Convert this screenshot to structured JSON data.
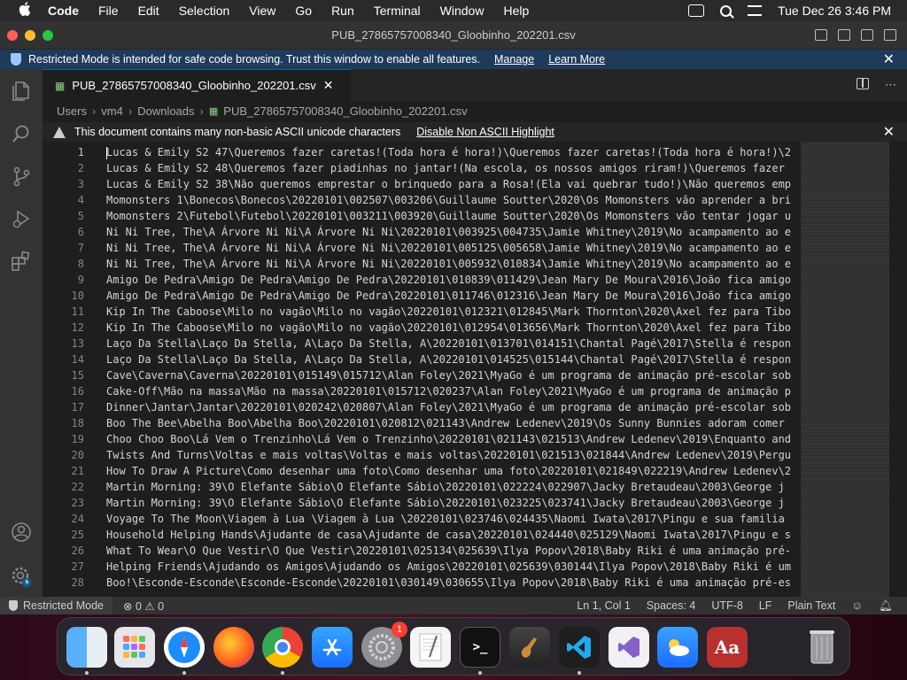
{
  "menubar": {
    "apple": "",
    "items": [
      "Code",
      "File",
      "Edit",
      "Selection",
      "View",
      "Go",
      "Run",
      "Terminal",
      "Window",
      "Help"
    ],
    "datetime": "Tue Dec 26  3:46 PM"
  },
  "window": {
    "title": "PUB_27865757008340_Gloobinho_202201.csv"
  },
  "banner": {
    "text": "Restricted Mode is intended for safe code browsing. Trust this window to enable all features.",
    "manage": "Manage",
    "learn_more": "Learn More",
    "close": "✕"
  },
  "tab": {
    "icon": "▦",
    "label": "PUB_27865757008340_Gloobinho_202201.csv",
    "close": "✕"
  },
  "breadcrumbs": [
    "Users",
    "vm4",
    "Downloads",
    "PUB_27865757008340_Gloobinho_202201.csv"
  ],
  "warning": {
    "text": "This document contains many non-basic ASCII unicode characters",
    "action": "Disable Non ASCII Highlight",
    "close": "✕"
  },
  "editor": {
    "lines": [
      {
        "n": "1",
        "text": "Lucas & Emily S2 47\\Queremos fazer caretas!(Toda hora é hora!)\\Queremos fazer caretas!(Toda hora é hora!)\\2"
      },
      {
        "n": "2",
        "text": "Lucas & Emily S2 48\\Queremos fazer piadinhas no jantar!(Na escola, os nossos amigos riram!)\\Queremos fazer"
      },
      {
        "n": "3",
        "text": "Lucas & Emily S2 38\\Não queremos emprestar o brinquedo para a Rosa!(Ela vai quebrar tudo!)\\Não queremos emp"
      },
      {
        "n": "4",
        "text": "Momonsters 1\\Bonecos\\Bonecos\\20220101\\002507\\003206\\Guillaume Soutter\\2020\\Os Momonsters vão aprender a bri"
      },
      {
        "n": "5",
        "text": "Momonsters 2\\Futebol\\Futebol\\20220101\\003211\\003920\\Guillaume Soutter\\2020\\Os Momonsters vão tentar jogar u"
      },
      {
        "n": "6",
        "text": "Ni Ni Tree, The\\A Árvore Ni Ni\\A Árvore Ni Ni\\20220101\\003925\\004735\\Jamie Whitney\\2019\\No acampamento ao e"
      },
      {
        "n": "7",
        "text": "Ni Ni Tree, The\\A Árvore Ni Ni\\A Árvore Ni Ni\\20220101\\005125\\005658\\Jamie Whitney\\2019\\No acampamento ao e"
      },
      {
        "n": "8",
        "text": "Ni Ni Tree, The\\A Árvore Ni Ni\\A Árvore Ni Ni\\20220101\\005932\\010834\\Jamie Whitney\\2019\\No acampamento ao e"
      },
      {
        "n": "9",
        "text": "Amigo De Pedra\\Amigo De Pedra\\Amigo De Pedra\\20220101\\010839\\011429\\Jean Mary De Moura\\2016\\João fica amigo"
      },
      {
        "n": "10",
        "text": "Amigo De Pedra\\Amigo De Pedra\\Amigo De Pedra\\20220101\\011746\\012316\\Jean Mary De Moura\\2016\\João fica amigo"
      },
      {
        "n": "11",
        "text": "Kip In The Caboose\\Milo no vagão\\Milo no vagão\\20220101\\012321\\012845\\Mark Thornton\\2020\\Axel fez para Tibo"
      },
      {
        "n": "12",
        "text": "Kip In The Caboose\\Milo no vagão\\Milo no vagão\\20220101\\012954\\013656\\Mark Thornton\\2020\\Axel fez para Tibo"
      },
      {
        "n": "13",
        "text": "Laço Da Stella\\Laço Da Stella, A\\Laço Da Stella, A\\20220101\\013701\\014151\\Chantal Pagé\\2017\\Stella é respon"
      },
      {
        "n": "14",
        "text": "Laço Da Stella\\Laço Da Stella, A\\Laço Da Stella, A\\20220101\\014525\\015144\\Chantal Pagé\\2017\\Stella é respon"
      },
      {
        "n": "15",
        "text": "Cave\\Caverna\\Caverna\\20220101\\015149\\015712\\Alan Foley\\2021\\MyaGo é um programa de animação pré-escolar sob"
      },
      {
        "n": "16",
        "text": "Cake-Off\\Mão na massa\\Mão na massa\\20220101\\015712\\020237\\Alan Foley\\2021\\MyaGo é um programa de animação p"
      },
      {
        "n": "17",
        "text": "Dinner\\Jantar\\Jantar\\20220101\\020242\\020807\\Alan Foley\\2021\\MyaGo é um programa de animação pré-escolar sob"
      },
      {
        "n": "18",
        "text": "Boo The Bee\\Abelha Boo\\Abelha Boo\\20220101\\020812\\021143\\Andrew Ledenev\\2019\\Os Sunny Bunnies adoram comer"
      },
      {
        "n": "19",
        "text": "Choo Choo Boo\\Lá Vem o Trenzinho\\Lá Vem o Trenzinho\\20220101\\021143\\021513\\Andrew Ledenev\\2019\\Enquanto and"
      },
      {
        "n": "20",
        "text": "Twists And Turns\\Voltas e mais voltas\\Voltas e mais voltas\\20220101\\021513\\021844\\Andrew Ledenev\\2019\\Pergu"
      },
      {
        "n": "21",
        "text": "How To Draw A Picture\\Como desenhar uma foto\\Como desenhar uma foto\\20220101\\021849\\022219\\Andrew Ledenev\\2"
      },
      {
        "n": "22",
        "text": "Martin Morning:  39\\O Elefante Sábio\\O Elefante Sábio\\20220101\\022224\\022907\\Jacky Bretaudeau\\2003\\George j"
      },
      {
        "n": "23",
        "text": "Martin Morning:  39\\O Elefante Sábio\\O Elefante Sábio\\20220101\\023225\\023741\\Jacky Bretaudeau\\2003\\George j"
      },
      {
        "n": "24",
        "text": "Voyage To The Moon\\Viagem à Lua \\Viagem à Lua \\20220101\\023746\\024435\\Naomi Iwata\\2017\\Pingu e sua familia"
      },
      {
        "n": "25",
        "text": "Household Helping Hands\\Ajudante de casa\\Ajudante de casa\\20220101\\024440\\025129\\Naomi Iwata\\2017\\Pingu e s"
      },
      {
        "n": "26",
        "text": "What To Wear\\O Que Vestir\\O Que Vestir\\20220101\\025134\\025639\\Ilya Popov\\2018\\Baby Riki é uma animação pré-"
      },
      {
        "n": "27",
        "text": "Helping Friends\\Ajudando os Amigos\\Ajudando os Amigos\\20220101\\025639\\030144\\Ilya Popov\\2018\\Baby Riki é um"
      },
      {
        "n": "28",
        "text": "Boo!\\Esconde-Esconde\\Esconde-Esconde\\20220101\\030149\\030655\\Ilya Popov\\2018\\Baby Riki é uma animação pré-es"
      }
    ]
  },
  "statusbar": {
    "restricted": "Restricted Mode",
    "problems": "⊗ 0 ⚠ 0",
    "position": "Ln 1, Col 1",
    "spaces": "Spaces: 4",
    "encoding": "UTF-8",
    "eol": "LF",
    "language": "Plain Text"
  },
  "dock": {
    "settings_badge": "1",
    "dictionary_label": "Aa"
  },
  "colors": {
    "banner_bg": "#1f3b5c",
    "accent": "#0e639c",
    "csv_icon": "#89d185"
  }
}
